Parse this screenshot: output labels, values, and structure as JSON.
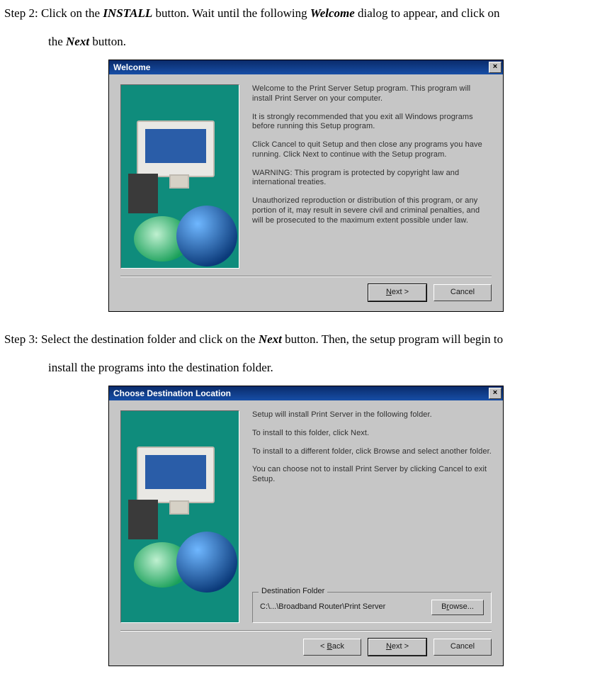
{
  "step2": {
    "label": "Step 2:",
    "text_a": "Click on the ",
    "bold1": "INSTALL",
    "text_b": " button. Wait until the following ",
    "bold2": "Welcome",
    "text_c": " dialog to appear, and click on",
    "text_d": "the ",
    "bold3": "Next",
    "text_e": " button."
  },
  "step3": {
    "label": "Step 3:",
    "text_a": "Select the destination folder and click on the ",
    "bold1": "Next",
    "text_b": " button. Then, the setup program will begin to",
    "text_c": "install the programs into the destination folder."
  },
  "dlg1": {
    "title": "Welcome",
    "close": "×",
    "p1": "Welcome to the Print Server Setup program.  This program will install Print Server on your computer.",
    "p2": "It is strongly recommended that you exit all Windows programs before running this Setup program.",
    "p3": "Click Cancel to quit Setup and then close any programs you have running.  Click Next to continue with the Setup program.",
    "p4": "WARNING: This program is protected by copyright law and international treaties.",
    "p5": "Unauthorized reproduction or distribution of this program, or any portion of it, may result in severe civil and criminal penalties, and will be prosecuted to the maximum extent possible under law.",
    "next_u": "N",
    "next_rest": "ext >",
    "cancel": "Cancel"
  },
  "dlg2": {
    "title": "Choose Destination Location",
    "close": "×",
    "p1": "Setup will install Print Server in the following folder.",
    "p2": "To install to this folder, click Next.",
    "p3": "To install to a different folder, click Browse and select another folder.",
    "p4": "You can choose not to install Print Server by clicking Cancel to exit Setup.",
    "dest_legend": "Destination Folder",
    "dest_path": "C:\\...\\Broadband Router\\Print Server",
    "browse_u": "r",
    "browse_pre": "B",
    "browse_post": "owse...",
    "back_pre": "< ",
    "back_u": "B",
    "back_post": "ack",
    "next_u": "N",
    "next_rest": "ext >",
    "cancel": "Cancel"
  }
}
